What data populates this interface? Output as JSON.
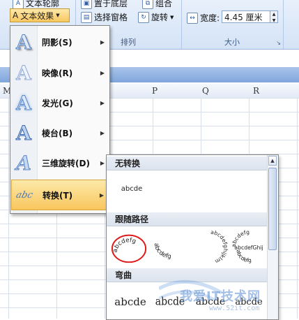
{
  "ribbon": {
    "outline_label": "文本轮廓",
    "text_effects_label": "文本效果",
    "bring_back_label": "置于底层",
    "selection_pane_label": "选择窗格",
    "group_label": "组合",
    "rotate_label": "旋转",
    "arrange_group": "排列",
    "width_label": "宽度:",
    "width_value": "4.45 厘米",
    "size_group": "大小"
  },
  "columns": [
    "M",
    "P",
    "Q",
    "R"
  ],
  "menu": {
    "items": [
      {
        "label": "阴影(S)",
        "icon": "shadow-a-icon"
      },
      {
        "label": "映像(R)",
        "icon": "reflection-a-icon"
      },
      {
        "label": "发光(G)",
        "icon": "glow-a-icon"
      },
      {
        "label": "棱台(B)",
        "icon": "bevel-a-icon"
      },
      {
        "label": "三维旋转(D)",
        "icon": "3d-rotation-a-icon"
      },
      {
        "label": "转换(T)",
        "icon": "transform-abc-icon"
      }
    ]
  },
  "submenu": {
    "sections": {
      "no_transform": "无转换",
      "follow_path": "跟随路径",
      "warp": "弯曲"
    },
    "sample_text": "abcde",
    "path_sample_text": "abcdefg",
    "circle_text": "abcdefghijklm",
    "button_text": "abcdefGhij"
  },
  "watermark": {
    "main": "我爱IT技术网",
    "sub": "www.52it.com"
  }
}
